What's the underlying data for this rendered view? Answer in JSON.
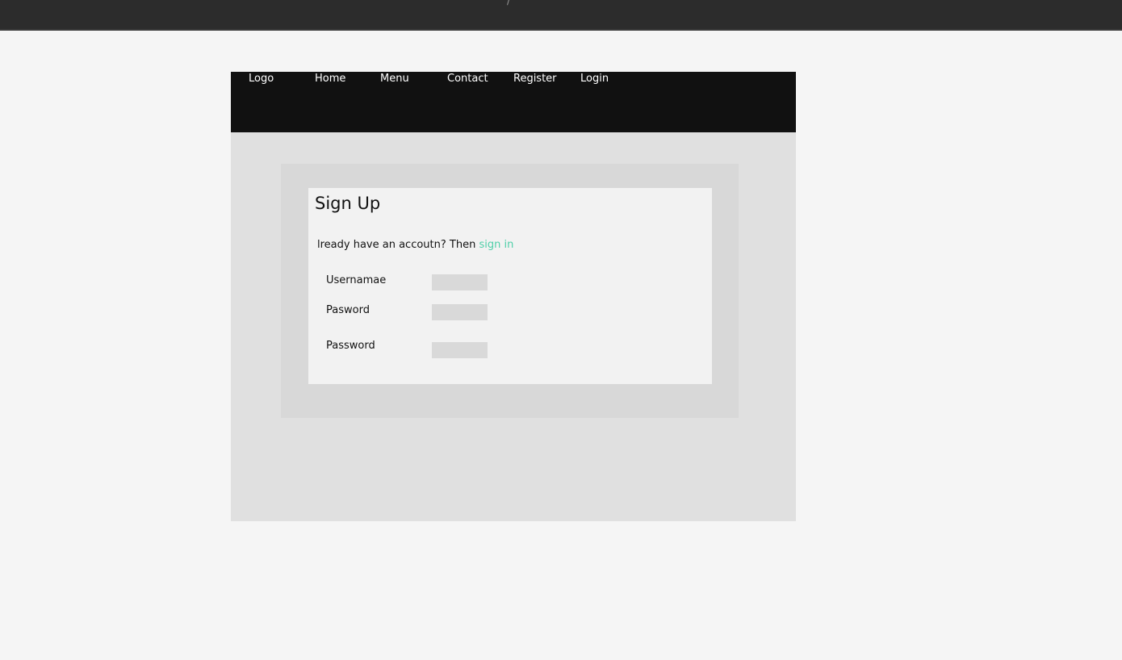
{
  "topbar": {
    "mark": "/"
  },
  "nav": {
    "logo": "Logo",
    "home": "Home",
    "menu": "Menu",
    "contact": "Contact",
    "register": "Register",
    "login": "Login"
  },
  "signup": {
    "title": "Sign Up",
    "prompt_text": "lready have an accoutn? Then ",
    "signin_link": "sign in",
    "fields": [
      {
        "label": "Usernamae",
        "value": ""
      },
      {
        "label": "Pasword",
        "value": ""
      },
      {
        "label": "Password",
        "value": ""
      }
    ]
  },
  "colors": {
    "topbar": "#2c2c2c",
    "navbar": "#111111",
    "page_bg": "#f5f5f5",
    "frame_bg": "#e0e0e0",
    "panel_bg": "#d8d8d8",
    "card_bg": "#f2f2f2",
    "input_bg": "#d9d9d9",
    "link": "#4ecfa8"
  }
}
